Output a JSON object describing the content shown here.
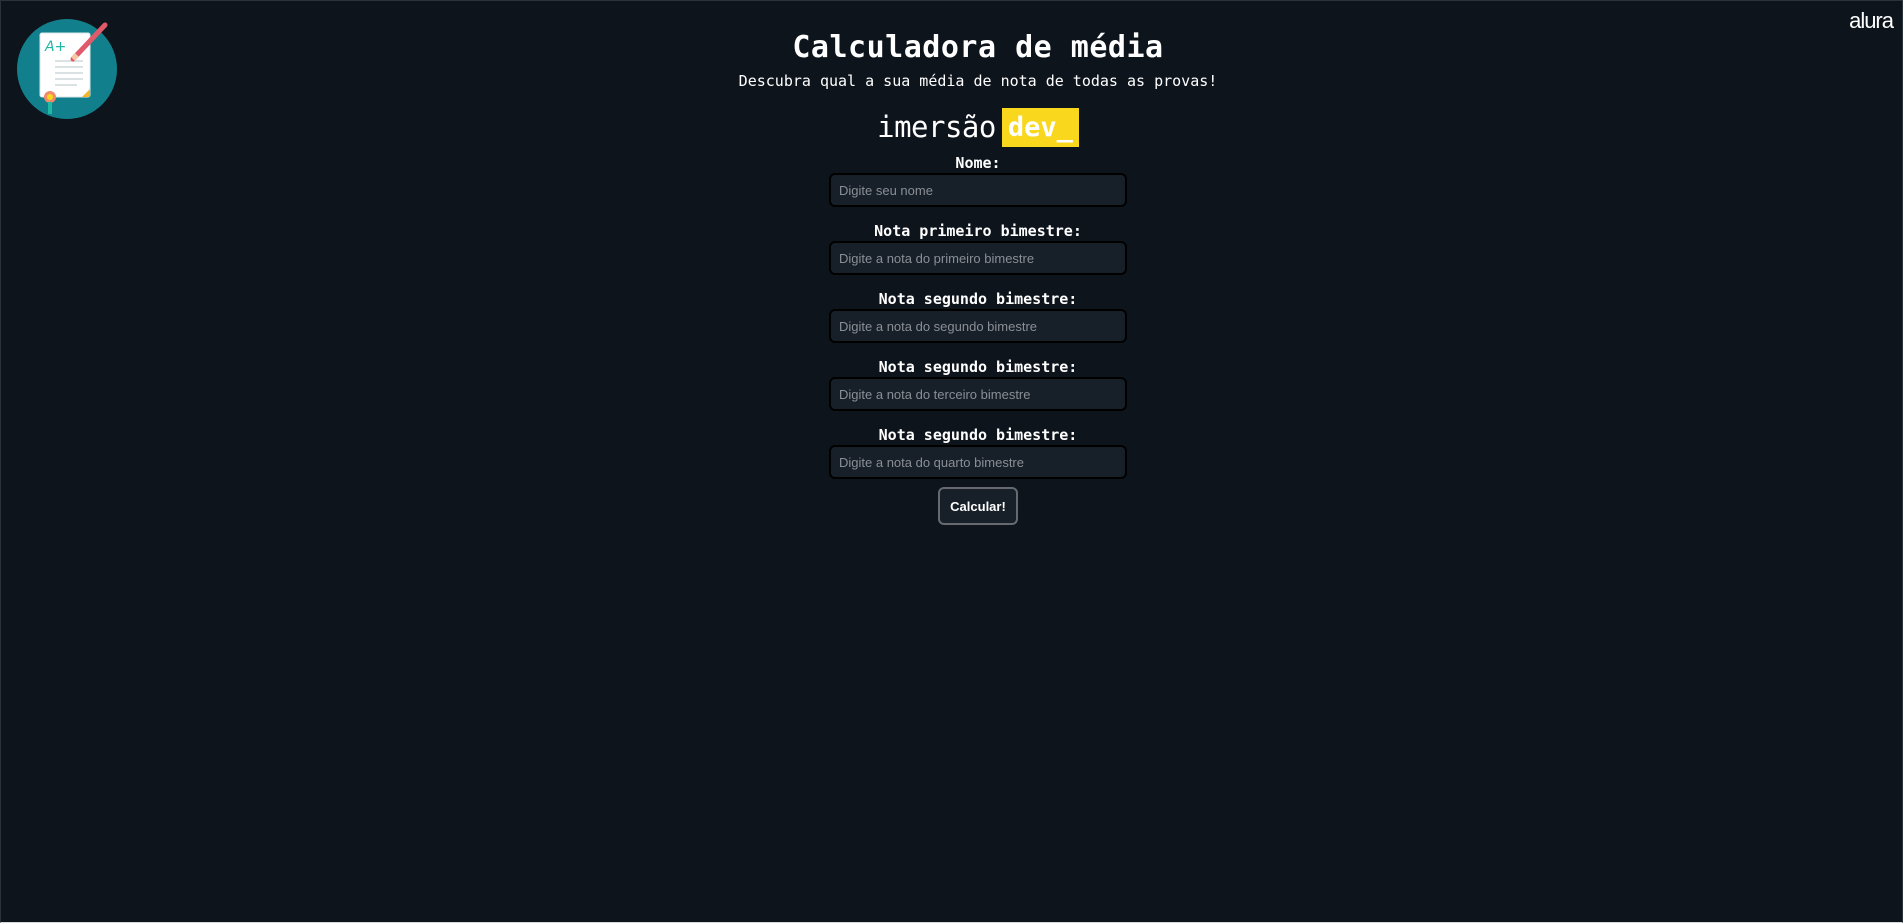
{
  "header": {
    "title": "Calculadora de média",
    "subtitle": "Descubra qual a sua média de nota de todas as provas!",
    "brand_left": "imersão",
    "brand_right": "dev_",
    "corner_logo": "alura",
    "logo_icon": "grade-sheet-a-plus-icon"
  },
  "form": {
    "fields": [
      {
        "label": "Nome:",
        "placeholder": "Digite seu nome",
        "value": ""
      },
      {
        "label": "Nota primeiro bimestre:",
        "placeholder": "Digite a nota do primeiro bimestre",
        "value": ""
      },
      {
        "label": "Nota segundo bimestre:",
        "placeholder": "Digite a nota do segundo bimestre",
        "value": ""
      },
      {
        "label": "Nota segundo bimestre:",
        "placeholder": "Digite a nota do terceiro bimestre",
        "value": ""
      },
      {
        "label": "Nota segundo bimestre:",
        "placeholder": "Digite a nota do quarto bimestre",
        "value": ""
      }
    ],
    "button_label": "Calcular!"
  },
  "colors": {
    "background": "#0d141c",
    "input_background": "#171f28",
    "accent_yellow": "#f9d71c",
    "logo_teal": "#0f7f8c"
  }
}
